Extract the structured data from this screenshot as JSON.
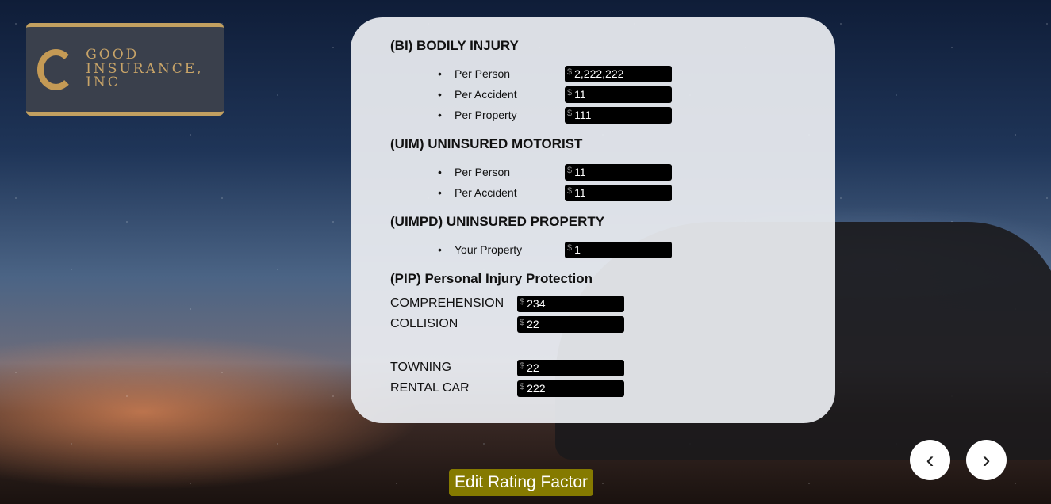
{
  "logo": {
    "line1": "GOOD",
    "line2": "INSURANCE, INC"
  },
  "sections": {
    "bi": {
      "title": "(BI) BODILY INJURY",
      "rows": [
        {
          "label": "Per Person",
          "value": "2,222,222"
        },
        {
          "label": "Per Accident",
          "value": "11"
        },
        {
          "label": "Per Property",
          "value": "111"
        }
      ]
    },
    "uim": {
      "title": "(UIM) UNINSURED MOTORIST",
      "rows": [
        {
          "label": "Per Person",
          "value": "11"
        },
        {
          "label": "Per Accident",
          "value": "11"
        }
      ]
    },
    "uimpd": {
      "title": "(UIMPD) UNINSURED PROPERTY",
      "rows": [
        {
          "label": "Your Property",
          "value": "1"
        }
      ]
    },
    "pip": {
      "title": "(PIP) Personal Injury Protection",
      "rows": [
        {
          "label": "COMPREHENSION",
          "value": "234"
        },
        {
          "label": "COLLISION",
          "value": "22"
        },
        {
          "label": "TOWNING",
          "value": "22"
        },
        {
          "label": "RENTAL CAR",
          "value": "222"
        }
      ]
    }
  },
  "currency": "$",
  "bullet": "•",
  "edit_button": "Edit Rating Factor",
  "nav": {
    "prev": "‹",
    "next": "›"
  },
  "colors": {
    "button": "#857a00",
    "field_bg": "#000000"
  }
}
